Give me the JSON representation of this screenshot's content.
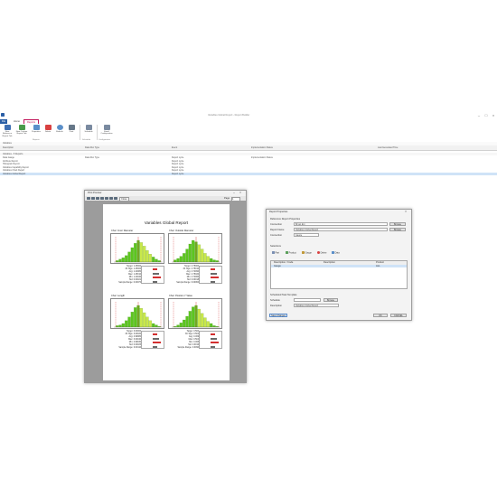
{
  "app": {
    "title": "Variables Global Report - Report Builder",
    "tabs": [
      "File",
      "Home",
      "Reports"
    ],
    "active_tab_index": 2,
    "ribbon": {
      "buttons": [
        {
          "label": "New Reference Report Tab",
          "icon": "new-report-icon",
          "color": "#3f6fb3"
        },
        {
          "label": "New Custom Report Tab",
          "icon": "custom-report-icon",
          "color": "#4a9a4a"
        },
        {
          "label": "Properties",
          "icon": "properties-icon",
          "color": "#5b8fc9"
        },
        {
          "label": "Delete",
          "icon": "delete-icon",
          "color": "#d94141"
        },
        {
          "label": "Refresh",
          "icon": "refresh-icon",
          "color": "#5b8fc9"
        },
        {
          "label": "Print",
          "icon": "print-icon",
          "color": "#667788"
        },
        {
          "label": "Schedule",
          "icon": "schedule-icon",
          "color": "#7a8aa0"
        },
        {
          "label": "Email Configuration",
          "icon": "email-icon",
          "color": "#7a8aa0"
        }
      ],
      "groups": [
        "Reports",
        "Schedule",
        "Configuration"
      ]
    },
    "grid": {
      "filter_label": "Variables",
      "columns": [
        "Description",
        "Data Run Type",
        "Event",
        "Implementation Status",
        "Last Generated Time"
      ],
      "category": "Variables - 5 Reports",
      "rows": [
        {
          "name": "Data Gauge",
          "type": "Data Run Type",
          "event": "Report cycle",
          "status": "Implementation Status",
          "time": ""
        },
        {
          "name": "Attribute Report",
          "type": "",
          "event": "Report cycle",
          "status": "",
          "time": ""
        },
        {
          "name": "Histogram Report",
          "type": "",
          "event": "Report cycle",
          "status": "",
          "time": ""
        },
        {
          "name": "Variables Capability Report",
          "type": "",
          "event": "Report cycle",
          "status": "",
          "time": ""
        },
        {
          "name": "Variables Chart Report",
          "type": "",
          "event": "Report cycle",
          "status": "",
          "time": ""
        },
        {
          "name": "Variables Global Report",
          "type": "",
          "event": "Report cycle",
          "status": "",
          "time": ""
        }
      ],
      "selected_row_index": 5
    }
  },
  "preview": {
    "window_title": "Print Preview",
    "toolbar_text": "Close",
    "page_label": "Page",
    "page_number": "1",
    "report_title": "Variables Global Report",
    "panels": [
      {
        "title": "Char: Inner Diameter",
        "stats": [
          "Target: 1.25000",
          "3K Sigs: 1.25000",
          "Avg: 1.24980",
          "Max: 1.25010",
          "Min: 1.24940",
          "Std: 0.00021",
          "Sample Range: 0.00070"
        ],
        "bars": [
          2,
          4,
          6,
          9,
          14,
          20,
          26,
          30,
          27,
          22,
          16,
          11,
          7,
          4,
          2
        ]
      },
      {
        "title": "Char: Outside Diameter",
        "stats": [
          "Target: 2.75000",
          "3K Sigs: 2.75010",
          "Avg: 2.74990",
          "Max: 2.75020",
          "Min: 2.74960",
          "Std: 0.00018",
          "Sample Range: 0.00060"
        ],
        "bars": [
          3,
          5,
          8,
          12,
          18,
          25,
          30,
          28,
          24,
          18,
          12,
          8,
          5,
          3,
          2
        ]
      },
      {
        "title": "Char: Length",
        "stats": [
          "Target: 3.00000",
          "3K Sigs: 3.00020",
          "Avg: 2.99980",
          "Max: 3.00040",
          "Min: 2.99930",
          "Std: 0.00025",
          "Sample Range: 0.00110"
        ],
        "bars": [
          2,
          3,
          5,
          9,
          14,
          21,
          27,
          30,
          26,
          20,
          14,
          9,
          5,
          3,
          1
        ]
      },
      {
        "title": "Char: Position Y Value",
        "stats": [
          "Target: 0.500",
          "3K Sigs: 0.502",
          "Avg: 0.499",
          "Max: 0.504",
          "Min: 0.495",
          "Std: 0.0016",
          "Sample Range: 0.0090"
        ],
        "bars": [
          1,
          3,
          6,
          10,
          15,
          22,
          28,
          30,
          25,
          19,
          13,
          8,
          5,
          2,
          1
        ]
      }
    ]
  },
  "dialog": {
    "title": "Report Properties",
    "section_label": "Reference Report Properties",
    "fields": [
      {
        "label": "Connection",
        "value": "Bryan Ext"
      },
      {
        "label": "Report Name",
        "value": "Variables Global Report"
      },
      {
        "label": "Connection",
        "value": "Gauge"
      }
    ],
    "browse_label": "Browse",
    "selections_label": "Selections",
    "tools": [
      "Part",
      "Product",
      "Gauge",
      "Delete",
      "Data"
    ],
    "table_columns": [
      "Description / Code",
      "Description",
      "Product"
    ],
    "table_row": {
      "code": "Gauge",
      "product": "ALL"
    },
    "schedule_label": "Scheduled Task Template",
    "schedule_field_label": "Schedule",
    "schedule_btn": "Browse",
    "description_label": "Description",
    "description_value": "Variables Global Report",
    "footer_left": "Save Changes",
    "ok_label": "OK",
    "cancel_label": "CANCEL"
  },
  "colors": {
    "accent": "#c2185b",
    "file_tab": "#2b5fa6",
    "selection": "#cfe3f7",
    "hist_bar": "#5cc51f",
    "hist_high": "#c9e84a"
  }
}
